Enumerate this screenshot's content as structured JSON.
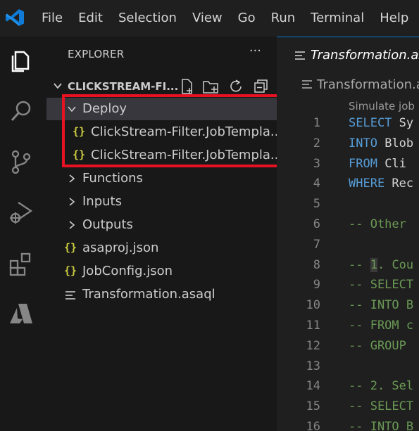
{
  "menu": [
    "File",
    "Edit",
    "Selection",
    "View",
    "Go",
    "Run",
    "Terminal",
    "Help"
  ],
  "activity_bar": [
    "explorer-icon",
    "search-icon",
    "source-control-icon",
    "run-debug-icon",
    "extensions-icon",
    "azure-icon"
  ],
  "sidebar": {
    "header": "EXPLORER",
    "more": "···",
    "project": "CLICKSTREAM-FI...",
    "project_actions": [
      "new-file-icon",
      "new-folder-icon",
      "refresh-icon",
      "collapse-all-icon"
    ],
    "tree": [
      {
        "label": "Deploy",
        "type": "folder",
        "expanded": true
      },
      {
        "label": "ClickStream-Filter.JobTempla...",
        "type": "json"
      },
      {
        "label": "ClickStream-Filter.JobTempla...",
        "type": "json"
      },
      {
        "label": "Functions",
        "type": "folder",
        "expanded": false
      },
      {
        "label": "Inputs",
        "type": "folder",
        "expanded": false
      },
      {
        "label": "Outputs",
        "type": "folder",
        "expanded": false
      },
      {
        "label": "asaproj.json",
        "type": "json"
      },
      {
        "label": "JobConfig.json",
        "type": "json"
      },
      {
        "label": "Transformation.asaql",
        "type": "asaql"
      }
    ],
    "json_glyph": "{}"
  },
  "editor": {
    "tab_label": "Transformation.asa",
    "breadcrumb": "Transformation.asa",
    "codelens": "Simulate job",
    "lines": [
      {
        "n": "1",
        "parts": [
          [
            "kw",
            "SELECT"
          ],
          [
            "id",
            " Sy"
          ]
        ]
      },
      {
        "n": "2",
        "parts": [
          [
            "kw",
            "INTO"
          ],
          [
            "id",
            " Blob"
          ]
        ]
      },
      {
        "n": "3",
        "parts": [
          [
            "kw",
            "FROM"
          ],
          [
            "id",
            " Cli"
          ]
        ]
      },
      {
        "n": "4",
        "parts": [
          [
            "kw",
            "WHERE"
          ],
          [
            "id",
            " Rec"
          ]
        ]
      },
      {
        "n": "5",
        "parts": []
      },
      {
        "n": "6",
        "parts": [
          [
            "cm",
            "-- Other "
          ]
        ]
      },
      {
        "n": "7",
        "parts": []
      },
      {
        "n": "8",
        "parts": [
          [
            "cm",
            "-- "
          ],
          [
            "num-hl",
            "1"
          ],
          [
            "cm",
            ". Cou"
          ]
        ]
      },
      {
        "n": "9",
        "parts": [
          [
            "cm",
            "-- SELECT"
          ]
        ]
      },
      {
        "n": "10",
        "parts": [
          [
            "cm",
            "-- INTO B"
          ]
        ]
      },
      {
        "n": "11",
        "parts": [
          [
            "cm",
            "-- FROM c"
          ]
        ]
      },
      {
        "n": "12",
        "parts": [
          [
            "cm",
            "-- GROUP "
          ]
        ]
      },
      {
        "n": "13",
        "parts": []
      },
      {
        "n": "14",
        "parts": [
          [
            "cm",
            "-- 2. Sel"
          ]
        ]
      },
      {
        "n": "15",
        "parts": [
          [
            "cm",
            "-- SELECT"
          ]
        ]
      },
      {
        "n": "16",
        "parts": [
          [
            "cm",
            "-- INTO B"
          ]
        ]
      }
    ]
  },
  "colors": {
    "highlight": "#e81123",
    "accent": "#0078d4",
    "json_icon": "#cbcb41",
    "keyword": "#569cd6",
    "comment": "#6a9955"
  }
}
